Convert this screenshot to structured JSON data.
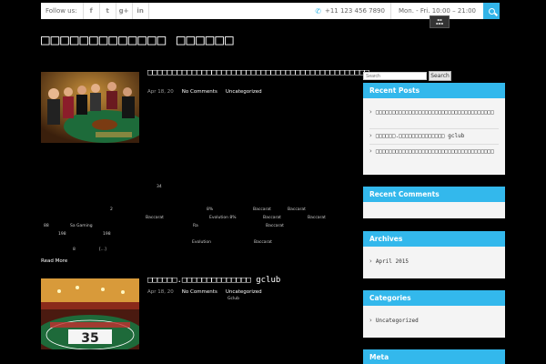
{
  "topbar": {
    "follow_label": "Follow us:",
    "social": [
      "f",
      "t",
      "g+",
      "in"
    ],
    "social_icons": [
      "facebook-icon",
      "twitter-icon",
      "google-plus-icon",
      "linkedin-icon"
    ],
    "phone": "+11 123 456 7890",
    "hours": "Mon. - Fri. 10:00 – 21:00"
  },
  "site": {
    "title": "□□□□□□□□□□□□□ □□□□□□"
  },
  "posts": [
    {
      "title": "□□□□□□□□□□□□□□□□□□□□□□□□□□□□□□□□□□□□□□□□□□□□□",
      "date": "Apr 18, 20",
      "comments": "No Comments",
      "category": "Uncategorized",
      "fragments": [
        "34",
        "2",
        "8%",
        "Baccarat",
        "Baccarat",
        "Baccarat",
        "Baccarat",
        "Evolution 8%",
        "Baccarat",
        "88",
        "Sa Gaming",
        "Ra",
        "Baccarat",
        "198",
        "198",
        "Evolution",
        "Baccarat",
        "8",
        "[...]"
      ],
      "read_more": "Read More"
    },
    {
      "title": "□□□□□□.□□□□□□□□□□□□□□ gclub",
      "date": "Apr 18, 20",
      "comments": "No Comments",
      "category": "Uncategorized",
      "fragments": [
        "Gclub"
      ]
    }
  ],
  "sidebar": {
    "search_placeholder": "Search",
    "search_button": "Search",
    "recent_posts": {
      "title": "Recent Posts",
      "items": [
        "□□□□□□□□□□□□□□□□□□□□□□□□□□□□□□□□□□□□",
        "□□□□□□.□□□□□□□□□□□□□□ gclub",
        "□□□□□□□□□□□□□□□□□□□□□□□□□□□□□□□□□□□□"
      ]
    },
    "recent_comments": {
      "title": "Recent Comments"
    },
    "archives": {
      "title": "Archives",
      "items": [
        "April 2015"
      ]
    },
    "categories": {
      "title": "Categories",
      "items": [
        "Uncategorized"
      ]
    },
    "meta": {
      "title": "Meta"
    }
  }
}
